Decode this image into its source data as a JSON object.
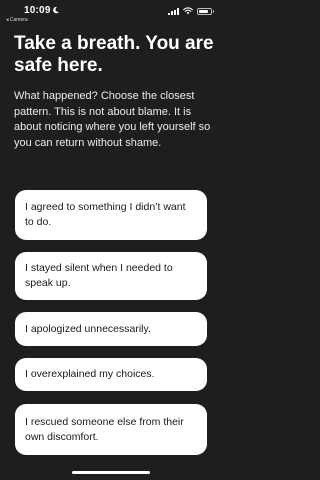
{
  "status_bar": {
    "time": "10:09",
    "back_label": "◂ Camera",
    "icons": [
      "moon-icon",
      "signal-icon",
      "wifi-icon",
      "battery-icon"
    ]
  },
  "screen": {
    "headline": "Take a breath. You are safe here.",
    "intro": "What happened? Choose the closest pattern. This is not about blame. It is about noticing where you left yourself so you can return without shame.",
    "options": [
      "I agreed to something I didn’t want to do.",
      "I stayed silent when I needed to speak up.",
      "I apologized unnecessarily.",
      "I overexplained my choices.",
      "I rescued someone else from their own discomfort."
    ]
  },
  "colors": {
    "background": "#1e1e1e",
    "card": "#ffffff",
    "card_text": "#1a1a1a",
    "text": "#ffffff"
  }
}
